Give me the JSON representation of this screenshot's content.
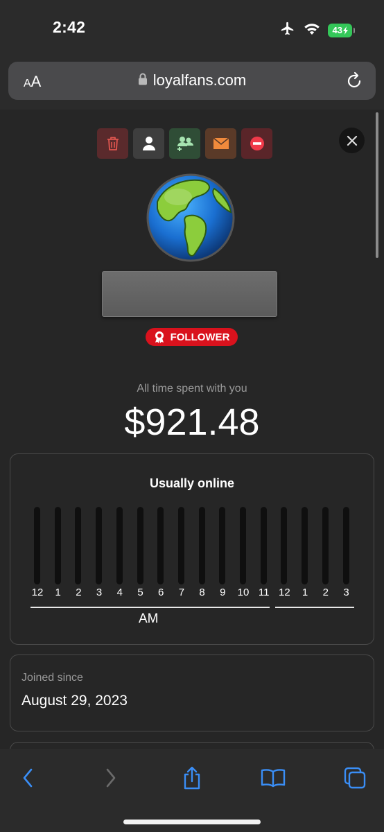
{
  "status": {
    "time": "2:42",
    "battery": "43",
    "icons": [
      "airplane-icon",
      "wifi-icon",
      "battery-icon"
    ]
  },
  "browser": {
    "aa_label_small": "A",
    "aa_label_large": "A",
    "url": "loyalfans.com"
  },
  "profile": {
    "actions": [
      "trash-icon",
      "user-icon",
      "add-group-icon",
      "envelope-icon",
      "block-icon"
    ],
    "badge": "FOLLOWER",
    "spent_label": "All time spent with you",
    "spent_amount": "$921.48"
  },
  "online": {
    "title": "Usually online",
    "hours": [
      "12",
      "1",
      "2",
      "3",
      "4",
      "5",
      "6",
      "7",
      "8",
      "9",
      "10",
      "11",
      "12",
      "1",
      "2",
      "3"
    ],
    "activity": [
      0,
      0,
      0,
      0,
      0,
      0,
      0,
      0,
      0,
      0,
      0,
      0,
      0,
      0,
      0,
      0
    ],
    "am_label": "AM"
  },
  "joined": {
    "label": "Joined since",
    "date": "August 29, 2023"
  },
  "colors": {
    "accent_blue": "#3a8ef6",
    "badge_red": "#d9121d",
    "battery_green": "#34c759"
  },
  "toolbar": [
    "back-icon",
    "forward-icon",
    "share-icon",
    "bookmarks-icon",
    "tabs-icon"
  ]
}
